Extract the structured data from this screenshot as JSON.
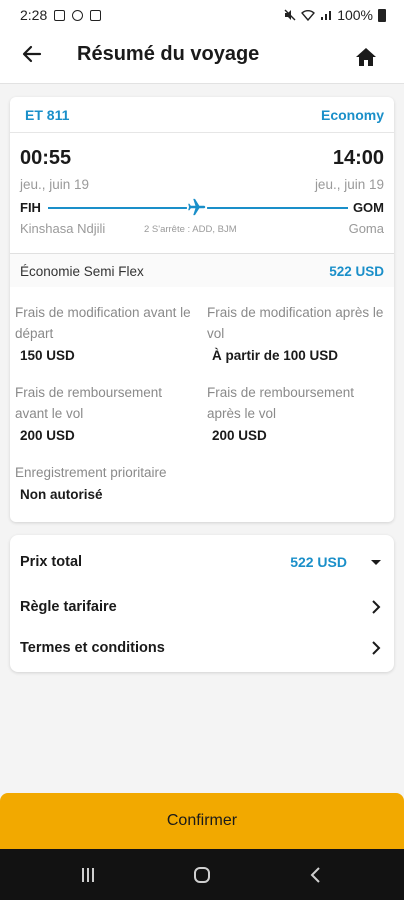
{
  "status_bar": {
    "time": "2:28",
    "battery": "100%"
  },
  "header": {
    "title": "Résumé du voyage"
  },
  "flight": {
    "number": "ET 811",
    "cabin": "Economy",
    "departure": {
      "time": "00:55",
      "date": "jeu., juin 19",
      "code": "FIH",
      "city": "Kinshasa Ndjili"
    },
    "arrival": {
      "time": "14:00",
      "date": "jeu., juin 19",
      "code": "GOM",
      "city": "Goma"
    },
    "stops": "2 S'arrête : ADD, BJM"
  },
  "fare": {
    "name": "Économie Semi Flex",
    "price": "522 USD",
    "rules": [
      {
        "label": "Frais de modification avant le départ",
        "value": "150 USD"
      },
      {
        "label": "Frais de modification après le vol",
        "value": "À partir de 100 USD"
      },
      {
        "label": "Frais de remboursement avant le vol",
        "value": "200 USD"
      },
      {
        "label": "Frais de remboursement après le vol",
        "value": "200 USD"
      },
      {
        "label": "Enregistrement prioritaire",
        "value": "Non autorisé"
      }
    ]
  },
  "summary": {
    "total_label": "Prix total",
    "total_value": "522 USD",
    "fare_rule_label": "Règle tarifaire",
    "terms_label": "Termes et conditions"
  },
  "confirm_label": "Confirmer",
  "colors": {
    "accent": "#1a8fc9",
    "confirm": "#f2a900",
    "navbar": "#121212"
  }
}
